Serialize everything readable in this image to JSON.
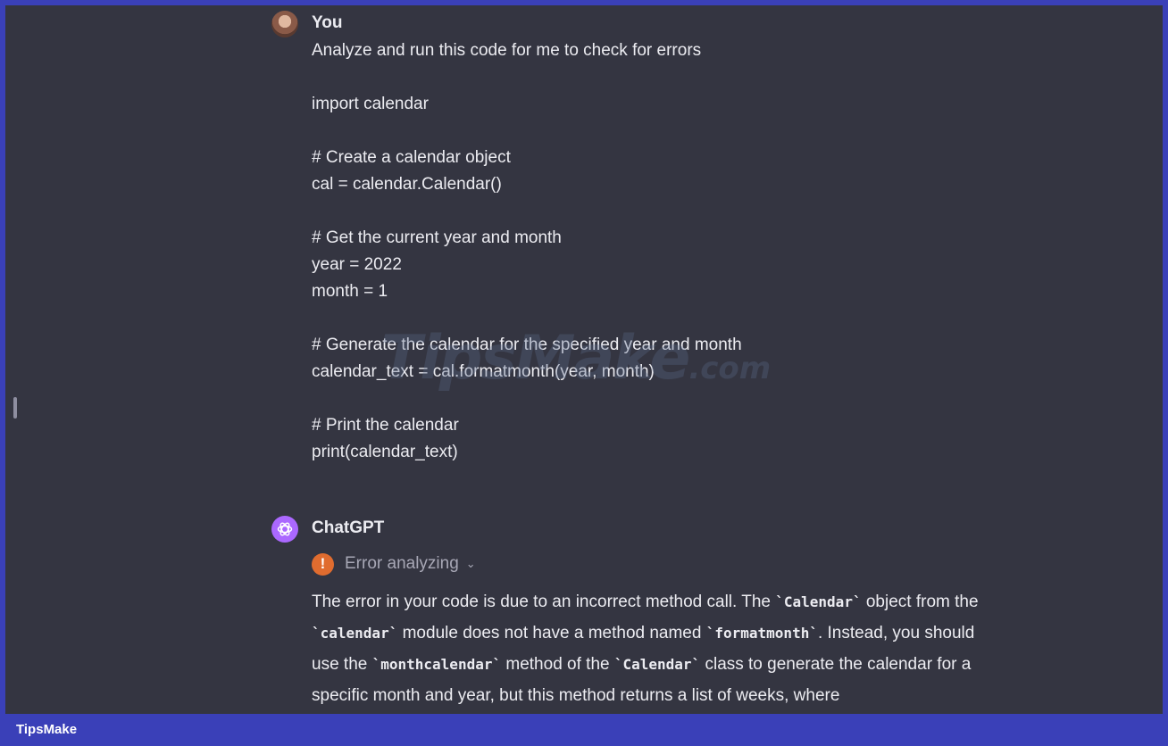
{
  "user": {
    "name": "You",
    "message": "Analyze and run this code for me to check for errors\n\nimport calendar\n\n# Create a calendar object\ncal = calendar.Calendar()\n\n# Get the current year and month\nyear = 2022\nmonth = 1\n\n# Generate the calendar for the specified year and month\ncalendar_text = cal.formatmonth(year, month)\n\n# Print the calendar\nprint(calendar_text)"
  },
  "assistant": {
    "name": "ChatGPT",
    "status_label": "Error analyzing",
    "response": {
      "t1": "The error in your code is due to an incorrect method call. The ",
      "c1": "`Calendar`",
      "t2": " object from the ",
      "c2": "`calendar`",
      "t3": " module does not have a method named ",
      "c3": "`formatmonth`",
      "t4": ". Instead, you should use the ",
      "c4": "`monthcalendar`",
      "t5": " method of the ",
      "c5": "`Calendar`",
      "t6": " class to generate the calendar for a specific month and year, but this method returns a list of weeks, where"
    }
  },
  "watermark": {
    "main": "TipsMake",
    "suffix": ".com"
  },
  "footer": {
    "brand": "TipsMake"
  },
  "icons": {
    "user_avatar": "user-avatar-photo",
    "assistant_avatar": "openai-logo-icon",
    "status_icon": "error-icon",
    "expand_icon": "chevron-down-icon"
  },
  "colors": {
    "background": "#343541",
    "frame": "#3a40b8",
    "assistant_avatar": "#ab68ff",
    "error": "#e06c2f"
  }
}
